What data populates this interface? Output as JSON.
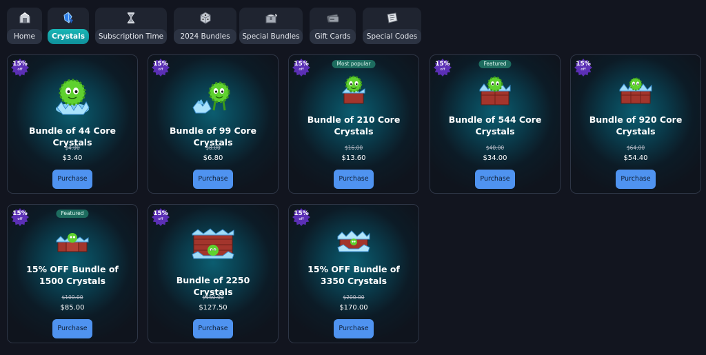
{
  "nav": {
    "tabs": [
      {
        "label": "Home",
        "icon": "home-icon",
        "active": false
      },
      {
        "label": "Crystals",
        "icon": "crystal-icon",
        "active": true
      },
      {
        "label": "Subscription Time",
        "icon": "hourglass-icon",
        "active": false
      },
      {
        "label": "2024 Bundles",
        "icon": "dice-icon",
        "active": false
      },
      {
        "label": "Special Bundles",
        "icon": "chest-icon",
        "active": false
      },
      {
        "label": "Gift Cards",
        "icon": "gift-card-icon",
        "active": false
      },
      {
        "label": "Special Codes",
        "icon": "ticket-icon",
        "active": false
      }
    ]
  },
  "products": [
    {
      "badge": "15%",
      "badge_sub": "off",
      "tag": "",
      "title": "Bundle of 44 Core Crystals",
      "old_price": "$4.00",
      "price": "$3.40",
      "button": "Purchase"
    },
    {
      "badge": "15%",
      "badge_sub": "off",
      "tag": "",
      "title": "Bundle of 99 Core Crystals",
      "old_price": "$8.00",
      "price": "$6.80",
      "button": "Purchase"
    },
    {
      "badge": "15%",
      "badge_sub": "off",
      "tag": "Most popular",
      "title": "Bundle of 210 Core Crystals",
      "old_price": "$16.00",
      "price": "$13.60",
      "button": "Purchase"
    },
    {
      "badge": "15%",
      "badge_sub": "off",
      "tag": "Featured",
      "title": "Bundle of 544 Core Crystals",
      "old_price": "$40.00",
      "price": "$34.00",
      "button": "Purchase"
    },
    {
      "badge": "15%",
      "badge_sub": "off",
      "tag": "",
      "title": "Bundle of 920 Core Crystals",
      "old_price": "$64.00",
      "price": "$54.40",
      "button": "Purchase"
    },
    {
      "badge": "15%",
      "badge_sub": "off",
      "tag": "Featured",
      "title": "15% OFF Bundle of 1500 Crystals",
      "old_price": "$100.00",
      "price": "$85.00",
      "button": "Purchase"
    },
    {
      "badge": "15%",
      "badge_sub": "off",
      "tag": "",
      "title": "Bundle of 2250 Crystals",
      "old_price": "$150.00",
      "price": "$127.50",
      "button": "Purchase"
    },
    {
      "badge": "15%",
      "badge_sub": "off",
      "tag": "",
      "title": "15% OFF Bundle of 3350 Crystals",
      "old_price": "$200.00",
      "price": "$170.00",
      "button": "Purchase"
    }
  ],
  "colors": {
    "background": "#12151f",
    "card_border": "#2e3646",
    "active_tab": "#19b7b6",
    "badge": "#5b2fb5",
    "button": "#4f93f0",
    "tag": "#1d6c5f"
  }
}
